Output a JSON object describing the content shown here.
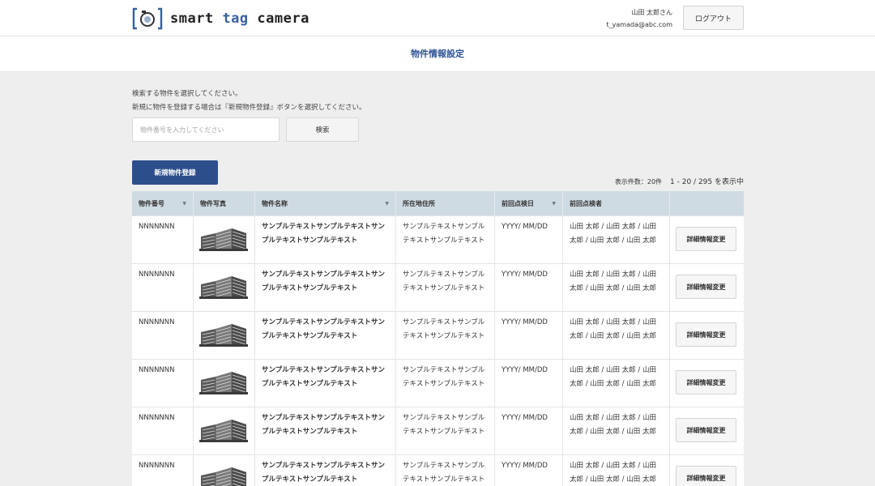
{
  "header": {
    "logo_bracket_open": "[",
    "logo_bracket_close": "]",
    "logo_word1": "smart",
    "logo_word2": "tag",
    "logo_word3": "camera",
    "user_name": "山田 太郎さん",
    "user_email": "t_yamada@abc.com",
    "logout_label": "ログアウト",
    "logo_icon": "camera-icon"
  },
  "page_title": "物件情報設定",
  "instructions": {
    "line1": "検索する物件を選択してください。",
    "line2": "新規に物件を登録する場合は『新規物件登録』ボタンを選択してください。"
  },
  "search": {
    "placeholder": "物件番号を入力してください",
    "button_label": "検索"
  },
  "new_button_label": "新規物件登録",
  "count": {
    "label": "表示件数：20件",
    "range": "1 - 20 / 295 を表示中"
  },
  "table": {
    "headers": [
      "物件番号",
      "物件写真",
      "物件名称",
      "所在地住所",
      "前回点検日",
      "前回点検者",
      ""
    ],
    "rows": [
      {
        "id": "NNNNNNN",
        "name": "サンプルテキストサンプルテキストサンプルテキストサンプルテキスト",
        "address": "サンプルテキストサンプルテキストサンプルテキスト",
        "date": "YYYY/ MM/DD",
        "inspector": "山田 太郎 / 山田 太郎 / 山田 太郎 / 山田 太郎 / 山田 太郎",
        "action": "詳細情報変更"
      },
      {
        "id": "NNNNNNN",
        "name": "サンプルテキストサンプルテキストサンプルテキストサンプルテキスト",
        "address": "サンプルテキストサンプルテキストサンプルテキスト",
        "date": "YYYY/ MM/DD",
        "inspector": "山田 太郎 / 山田 太郎 / 山田 太郎 / 山田 太郎 / 山田 太郎",
        "action": "詳細情報変更"
      },
      {
        "id": "NNNNNNN",
        "name": "サンプルテキストサンプルテキストサンプルテキストサンプルテキスト",
        "address": "サンプルテキストサンプルテキストサンプルテキスト",
        "date": "YYYY/ MM/DD",
        "inspector": "山田 太郎 / 山田 太郎 / 山田 太郎 / 山田 太郎 / 山田 太郎",
        "action": "詳細情報変更"
      },
      {
        "id": "NNNNNNN",
        "name": "サンプルテキストサンプルテキストサンプルテキストサンプルテキスト",
        "address": "サンプルテキストサンプルテキストサンプルテキスト",
        "date": "YYYY/ MM/DD",
        "inspector": "山田 太郎 / 山田 太郎 / 山田 太郎 / 山田 太郎 / 山田 太郎",
        "action": "詳細情報変更"
      },
      {
        "id": "NNNNNNN",
        "name": "サンプルテキストサンプルテキストサンプルテキストサンプルテキスト",
        "address": "サンプルテキストサンプルテキストサンプルテキスト",
        "date": "YYYY/ MM/DD",
        "inspector": "山田 太郎 / 山田 太郎 / 山田 太郎 / 山田 太郎 / 山田 太郎",
        "action": "詳細情報変更"
      },
      {
        "id": "NNNNNNN",
        "name": "サンプルテキストサンプルテキストサンプルテキストサンプルテキスト",
        "address": "サンプルテキストサンプルテキストサンプルテキスト",
        "date": "YYYY/ MM/DD",
        "inspector": "山田 太郎 / 山田 太郎 / 山田 太郎 / 山田 太郎 / 山田 太郎",
        "action": "詳細情報変更"
      }
    ]
  },
  "colors": {
    "accent": "#2c4f8c",
    "table_header": "#cfdbe3",
    "background": "#eeeeee"
  }
}
